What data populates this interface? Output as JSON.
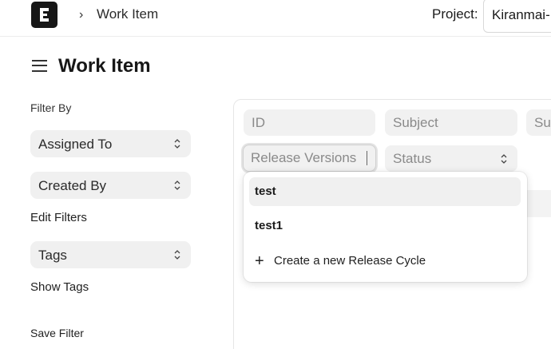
{
  "navbar": {
    "logo_icon": "app-logo-e",
    "breadcrumb_separator": "›",
    "breadcrumb": "Work Item",
    "project_label": "Project:",
    "project_value": "Kiranmai-"
  },
  "header": {
    "menu_icon": "hamburger-icon",
    "title": "Work Item"
  },
  "sidebar": {
    "filter_by_label": "Filter By",
    "assigned_to": "Assigned To",
    "created_by": "Created By",
    "edit_filters": "Edit Filters",
    "tags": "Tags",
    "show_tags": "Show Tags",
    "save_filter": "Save Filter"
  },
  "filters": {
    "id_placeholder": "ID",
    "subject_placeholder": "Subject",
    "third_placeholder": "Su",
    "release_versions_placeholder": "Release Versions",
    "status_placeholder": "Status"
  },
  "dropdown": {
    "options": [
      "test",
      "test1"
    ],
    "create_label": "Create a new Release Cycle"
  },
  "colors": {
    "logo_bg": "#171717",
    "input_bg": "#f1f1f1",
    "active_option_bg": "#f0f0f0"
  }
}
